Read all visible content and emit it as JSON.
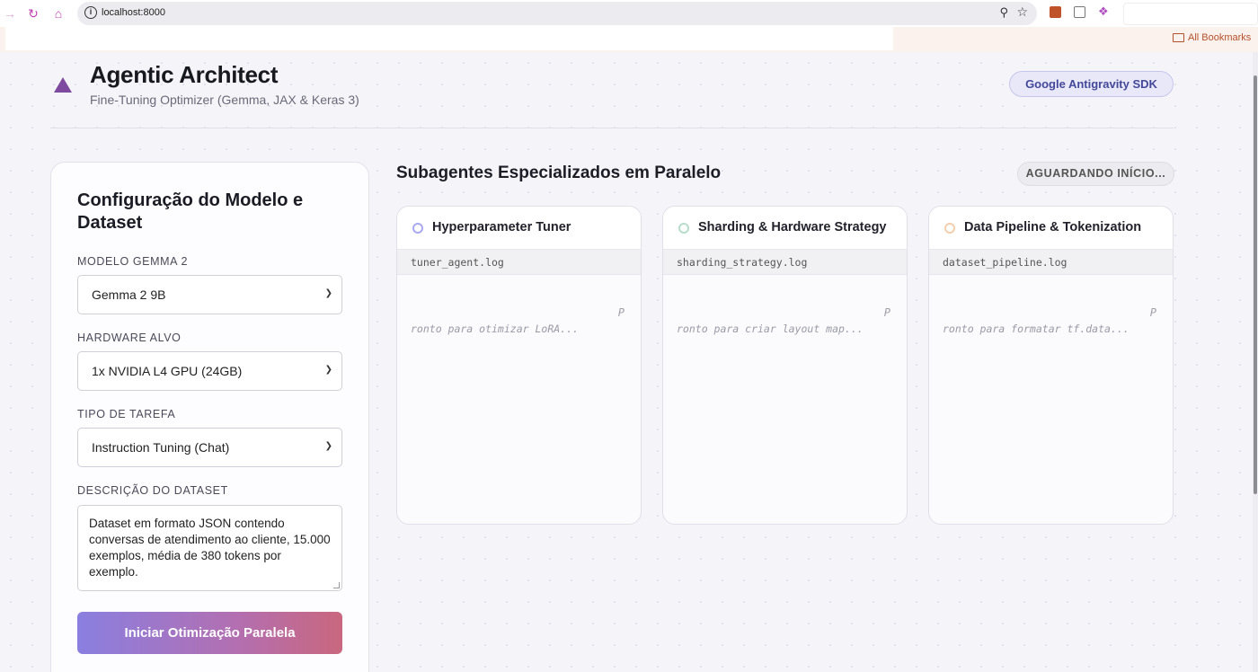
{
  "browser": {
    "url": "localhost:8000",
    "bookmarks_label": "All Bookmarks",
    "url_info_icon": "i"
  },
  "header": {
    "title": "Agentic Architect",
    "subtitle": "Fine-Tuning Optimizer (Gemma, JAX & Keras 3)",
    "badge": "Google Antigravity SDK"
  },
  "config": {
    "title": "Configuração do Modelo e Dataset",
    "model_label": "MODELO GEMMA 2",
    "model_value": "Gemma 2 9B",
    "hardware_label": "HARDWARE ALVO",
    "hardware_value": "1x NVIDIA L4 GPU (24GB)",
    "task_label": "TIPO DE TAREFA",
    "task_value": "Instruction Tuning (Chat)",
    "dataset_label": "DESCRIÇÃO DO DATASET",
    "dataset_value": "Dataset em formato JSON contendo conversas de atendimento ao cliente, 15.000 exemplos, média de 380 tokens por exemplo.",
    "run_button": "Iniciar Otimização Paralela"
  },
  "agents_section": {
    "title": "Subagentes Especializados em Paralelo",
    "status": "AGUARDANDO INÍCIO..."
  },
  "agents": [
    {
      "name": "Hyperparameter Tuner",
      "log": "tuner_agent.log",
      "glyph": "P",
      "message": "ronto para otimizar LoRA...",
      "color": "#a9a9f2"
    },
    {
      "name": "Sharding & Hardware Strategy",
      "log": "sharding_strategy.log",
      "glyph": "P",
      "message": "ronto para criar layout map...",
      "color": "#b7dccb"
    },
    {
      "name": "Data Pipeline & Tokenization",
      "log": "dataset_pipeline.log",
      "glyph": "P",
      "message": "ronto para formatar tf.data...",
      "color": "#f3cfae"
    }
  ]
}
